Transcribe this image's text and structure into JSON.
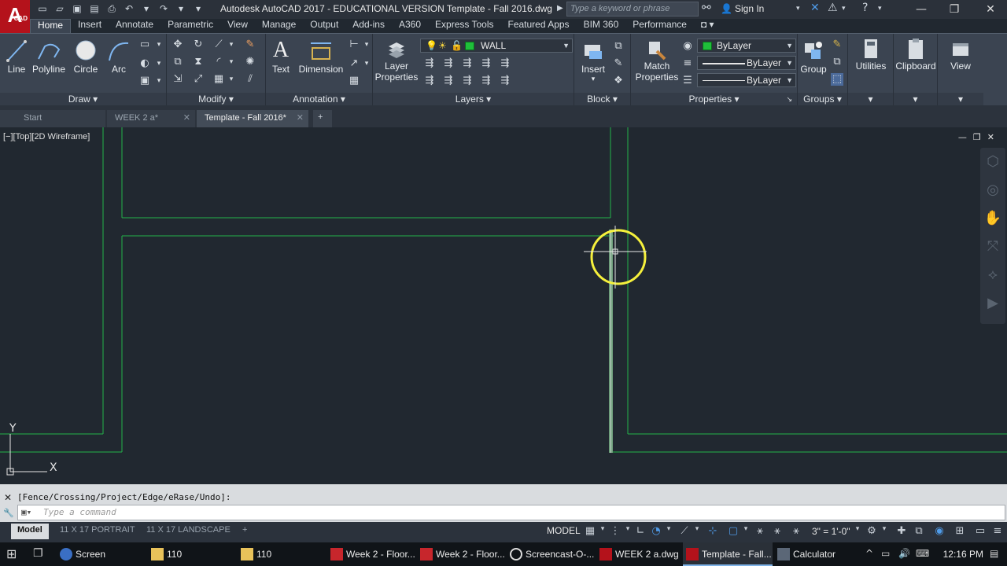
{
  "titlebar": {
    "app_logo_letter": "A",
    "app_logo_sub": "CAD",
    "title": "Autodesk AutoCAD 2017 - EDUCATIONAL VERSION    Template - Fall 2016.dwg",
    "search_placeholder": "Type a keyword or phrase",
    "sign_in": "Sign In"
  },
  "ribbon_tabs": [
    "Home",
    "Insert",
    "Annotate",
    "Parametric",
    "View",
    "Manage",
    "Output",
    "Add-ins",
    "A360",
    "Express Tools",
    "Featured Apps",
    "BIM 360",
    "Performance"
  ],
  "ribbon": {
    "draw": {
      "title": "Draw",
      "tools": [
        "Line",
        "Polyline",
        "Circle",
        "Arc"
      ]
    },
    "modify": {
      "title": "Modify"
    },
    "annotation": {
      "title": "Annotation",
      "text": "Text",
      "dimension": "Dimension"
    },
    "layers": {
      "title": "Layers",
      "layer_properties_line1": "Layer",
      "layer_properties_line2": "Properties",
      "current_layer": "WALL",
      "layer_color": "#1fbf3a"
    },
    "block": {
      "title": "Block",
      "insert": "Insert"
    },
    "properties": {
      "title": "Properties",
      "match_line1": "Match",
      "match_line2": "Properties",
      "color": "ByLayer",
      "linetype": "ByLayer",
      "lineweight": "ByLayer"
    },
    "groups": {
      "title": "Groups",
      "group": "Group"
    },
    "utilities": "Utilities",
    "clipboard": "Clipboard",
    "view": "View"
  },
  "doc_tabs": [
    {
      "label": "Start"
    },
    {
      "label": "WEEK 2 a*"
    },
    {
      "label": "Template - Fall 2016*"
    }
  ],
  "viewport": {
    "label": "[−][Top][2D Wireframe]",
    "ucs_x": "X",
    "ucs_y": "Y",
    "wall_color": "#23b34a",
    "cursor_highlight_color": "#f5f03c"
  },
  "command": {
    "history": "[Fence/Crossing/Project/Edge/eRase/Undo]:",
    "placeholder": "Type a command"
  },
  "layout_tabs": [
    "Model",
    "11 X 17 PORTRAIT",
    "11 X 17 LANDSCAPE"
  ],
  "status": {
    "model": "MODEL",
    "scale": "3\" = 1'-0\""
  },
  "taskbar": {
    "items": [
      "Screen Record...",
      "110",
      "110",
      "Week 2 - Floor...",
      "Week 2 - Floor...",
      "Screencast-O-...",
      "WEEK 2 a.dwg",
      "Template - Fall...",
      "Calculator"
    ],
    "time": "12:16 PM"
  }
}
